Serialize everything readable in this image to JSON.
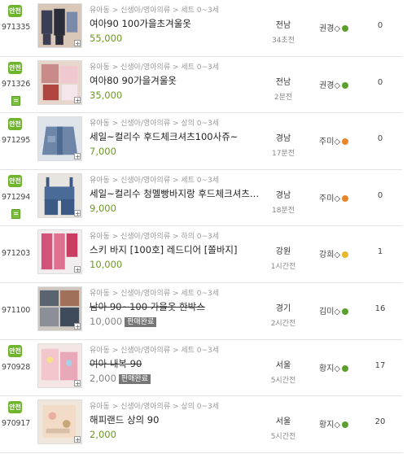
{
  "safe_badge_label": "안전",
  "items": [
    {
      "id": "971335",
      "safe": true,
      "doc": false,
      "category": "유아동 > 신생아/영아의류 > 세트 0~3세",
      "title": "여아90 100가을초겨울옷",
      "price": "55,000",
      "sold": false,
      "region": "전남",
      "time": "34초전",
      "seller": "권경◇",
      "seller_dot_color": "#5aa02c",
      "views": "0"
    },
    {
      "id": "971326",
      "safe": true,
      "doc": true,
      "category": "유아동 > 신생아/영아의류 > 세트 0~3세",
      "title": "여아80 90가을겨울옷",
      "price": "35,000",
      "sold": false,
      "region": "전남",
      "time": "2분전",
      "seller": "권경◇",
      "seller_dot_color": "#5aa02c",
      "views": "0"
    },
    {
      "id": "971295",
      "safe": true,
      "doc": false,
      "category": "유아동 > 신생아/영아의류 > 상의 0~3세",
      "title": "세일~컬리수 후드체크셔츠100사쥬~",
      "price": "7,000",
      "sold": false,
      "region": "경남",
      "time": "17분전",
      "seller": "주미◇",
      "seller_dot_color": "#e8862a",
      "views": "0"
    },
    {
      "id": "971294",
      "safe": true,
      "doc": true,
      "category": "유아동 > 신생아/영아의류 > 세트 0~3세",
      "title": "세일~컬리수 청멜빵바지랑 후드체크셔츠…",
      "price": "9,000",
      "sold": false,
      "region": "경남",
      "time": "18분전",
      "seller": "주미◇",
      "seller_dot_color": "#e8862a",
      "views": "0"
    },
    {
      "id": "971203",
      "safe": false,
      "doc": false,
      "category": "유아동 > 신생아/영아의류 > 하의 0~3세",
      "title": "스키 바지 [100호] 레드디어 [쫄바지]",
      "price": "10,000",
      "sold": false,
      "region": "강원",
      "time": "1시간전",
      "seller": "강희◇",
      "seller_dot_color": "#e8b82a",
      "views": "1"
    },
    {
      "id": "971100",
      "safe": false,
      "doc": false,
      "category": "유아동 > 신생아/영아의류 > 세트 0~3세",
      "title": "남아 90~100 가을옷 한박스",
      "price": "10,000",
      "sold": true,
      "sold_label": "판매완료",
      "region": "경기",
      "time": "2시간전",
      "seller": "김미◇",
      "seller_dot_color": "#5aa02c",
      "views": "16"
    },
    {
      "id": "970928",
      "safe": true,
      "doc": false,
      "category": "유아동 > 신생아/영아의류 > 세트 0~3세",
      "title": "여아 내복 90",
      "price": "2,000",
      "sold": true,
      "sold_label": "판매완료",
      "region": "서울",
      "time": "5시간전",
      "seller": "황지◇",
      "seller_dot_color": "#5aa02c",
      "views": "17"
    },
    {
      "id": "970917",
      "safe": true,
      "doc": false,
      "category": "유아동 > 신생아/영아의류 > 상의 0~3세",
      "title": "해피랜드 상의 90",
      "price": "2,000",
      "sold": false,
      "region": "서울",
      "time": "5시간전",
      "seller": "황지◇",
      "seller_dot_color": "#5aa02c",
      "views": "20"
    }
  ]
}
